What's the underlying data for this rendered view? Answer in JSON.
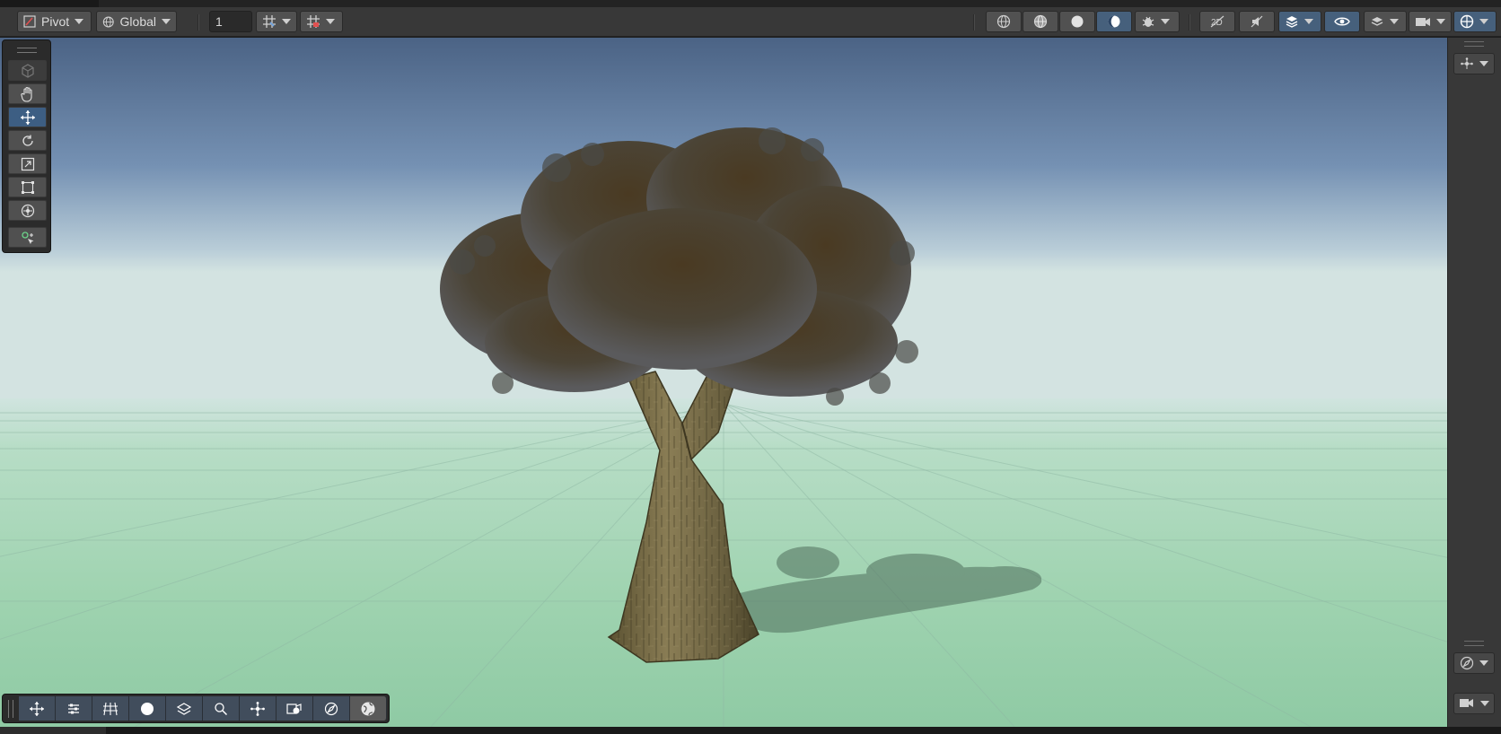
{
  "toolbar": {
    "pivot_label": "Pivot",
    "global_label": "Global",
    "grid_snap_value": "1"
  },
  "tools": [
    {
      "name": "view-tool",
      "icon": "cube-icon",
      "active": false
    },
    {
      "name": "hand-tool",
      "icon": "hand-icon",
      "active": false
    },
    {
      "name": "move-tool",
      "icon": "move-arrows-icon",
      "active": true
    },
    {
      "name": "rotate-tool",
      "icon": "rotate-icon",
      "active": false
    },
    {
      "name": "scale-tool",
      "icon": "scale-icon",
      "active": false
    },
    {
      "name": "rect-tool",
      "icon": "rect-transform-icon",
      "active": false
    },
    {
      "name": "transform-tool",
      "icon": "transform-icon",
      "active": false
    },
    {
      "name": "custom-tool",
      "icon": "custom-editor-tool-icon",
      "active": false
    }
  ],
  "view_options": [
    "move-icon",
    "settings-sliders-icon",
    "grid-icon",
    "sphere-icon",
    "layers-icon",
    "search-icon",
    "orientation-gizmo-icon",
    "camera-icon",
    "compass-icon",
    "globe-icon"
  ],
  "colors": {
    "accent": "#3d5e83",
    "toolbar_bg": "#383838",
    "sky_top": "#4b6385",
    "ground": "#9fd3b0"
  }
}
